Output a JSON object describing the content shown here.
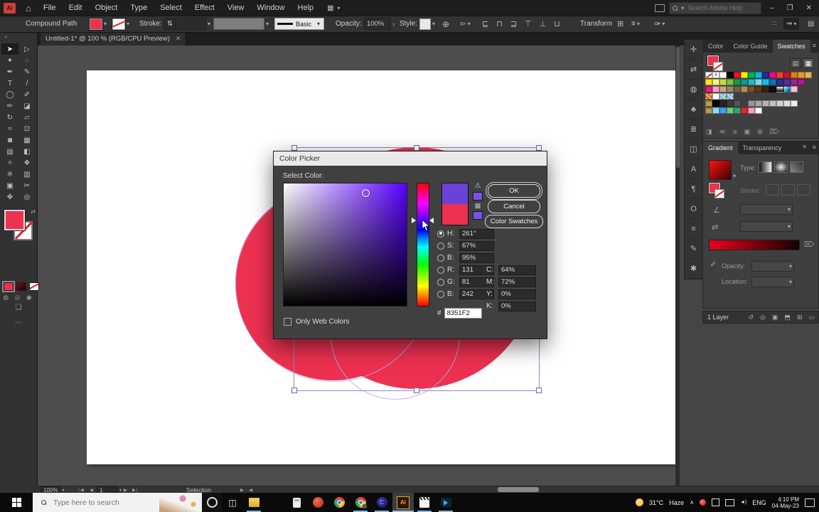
{
  "branding": {
    "ai_badge": "Ai"
  },
  "menubar": {
    "items": [
      "File",
      "Edit",
      "Object",
      "Type",
      "Select",
      "Effect",
      "View",
      "Window",
      "Help"
    ],
    "search_placeholder": "Search Adobe Help"
  },
  "control_bar": {
    "context_label": "Compound Path",
    "stroke_label": "Stroke:",
    "basic_label": "Basic",
    "opacity_label": "Opacity:",
    "opacity_value": "100%",
    "style_label": "Style:",
    "transform_label": "Transform",
    "align_glyphs": [
      "⊑",
      "⊓",
      "⊒",
      "⊤",
      "⊥",
      "⊔"
    ]
  },
  "document": {
    "tab_title": "Untitled-1* @ 100 % (RGB/CPU Preview)"
  },
  "toolbar": {
    "tools": [
      {
        "name": "selection",
        "glyph": "➤",
        "active": true
      },
      {
        "name": "direct-selection",
        "glyph": "▷"
      },
      {
        "name": "magic-wand",
        "glyph": "✦"
      },
      {
        "name": "lasso",
        "glyph": "◌"
      },
      {
        "name": "pen",
        "glyph": "✒"
      },
      {
        "name": "curvature",
        "glyph": "✎"
      },
      {
        "name": "type",
        "glyph": "T"
      },
      {
        "name": "line-segment",
        "glyph": "/"
      },
      {
        "name": "ellipse",
        "glyph": "◯"
      },
      {
        "name": "paintbrush",
        "glyph": "✐"
      },
      {
        "name": "pencil",
        "glyph": "✏"
      },
      {
        "name": "eraser",
        "glyph": "◪"
      },
      {
        "name": "rotate",
        "glyph": "↻"
      },
      {
        "name": "scale",
        "glyph": "▱"
      },
      {
        "name": "width",
        "glyph": "≈"
      },
      {
        "name": "free-transform",
        "glyph": "⊡"
      },
      {
        "name": "shape-builder",
        "glyph": "◙"
      },
      {
        "name": "perspective-grid",
        "glyph": "▦"
      },
      {
        "name": "mesh",
        "glyph": "▤"
      },
      {
        "name": "gradient",
        "glyph": "◧"
      },
      {
        "name": "eyedropper",
        "glyph": "✧"
      },
      {
        "name": "blend",
        "glyph": "❖"
      },
      {
        "name": "symbol-sprayer",
        "glyph": "※"
      },
      {
        "name": "column-graph",
        "glyph": "▥"
      },
      {
        "name": "artboard",
        "glyph": "▣"
      },
      {
        "name": "slice",
        "glyph": "✂"
      },
      {
        "name": "hand",
        "glyph": "✥"
      },
      {
        "name": "zoom",
        "glyph": "◎"
      }
    ],
    "more_glyph": "…"
  },
  "canvas": {
    "artwork_color": "#ED3150"
  },
  "dialog": {
    "title": "Color Picker",
    "select_label": "Select Color:",
    "ok": "OK",
    "cancel": "Cancel",
    "color_swatches": "Color Swatches",
    "only_web": "Only Web Colors",
    "hue_degrees": 261,
    "new_color": "#6B41D9",
    "current_color": "#ED3150",
    "rows": [
      {
        "key": "h",
        "label": "H:",
        "value": "261°",
        "selected": true
      },
      {
        "key": "s",
        "label": "S:",
        "value": "67%"
      },
      {
        "key": "b",
        "label": "B:",
        "value": "95%"
      },
      {
        "key": "r",
        "label": "R:",
        "value": "131"
      },
      {
        "key": "g",
        "label": "G:",
        "value": "81"
      },
      {
        "key": "b2",
        "label": "B:",
        "value": "242"
      }
    ],
    "cmyk": [
      {
        "label": "C:",
        "value": "64%"
      },
      {
        "label": "M:",
        "value": "72%"
      },
      {
        "label": "Y:",
        "value": "0%"
      },
      {
        "label": "K:",
        "value": "0%"
      }
    ],
    "hex_label": "#",
    "hex_value": "8351F2"
  },
  "dock": {
    "icons": [
      {
        "name": "transform",
        "glyph": "✛"
      },
      {
        "name": "properties",
        "glyph": "⇄"
      },
      {
        "name": "appearance",
        "glyph": "◍"
      },
      {
        "name": "symbols",
        "glyph": "♣"
      },
      {
        "name": "align",
        "glyph": "≣"
      },
      {
        "name": "pathfinder",
        "glyph": "◫"
      },
      {
        "name": "character",
        "glyph": "A"
      },
      {
        "name": "paragraph",
        "glyph": "¶"
      },
      {
        "name": "glyphs",
        "glyph": "O"
      },
      {
        "name": "stroke",
        "glyph": "≡"
      },
      {
        "name": "graphic-styles",
        "glyph": "✎"
      },
      {
        "name": "actions",
        "glyph": "✱"
      }
    ]
  },
  "swatches_panel": {
    "tabs": [
      {
        "label": "Color"
      },
      {
        "label": "Color Guide"
      },
      {
        "label": "Swatches",
        "active": true
      }
    ],
    "rows": [
      [
        "none",
        "reg",
        "#ffffff",
        "#000000",
        "#e8112d",
        "#f7ea0f",
        "#0db14b",
        "#0bb7e8",
        "#1e2f8f",
        "#e80b8c",
        "#e8432a",
        "#c4153f",
        "#e87a12",
        "#e89a2d",
        "#ecb34e"
      ],
      [
        "#f7e71c",
        "#fbf383",
        "#c9dc45",
        "#7cc245",
        "#159c4a",
        "#0d9e8d",
        "#2fb5c8",
        "#83d5e6",
        "#14bdf0",
        "#1272b8",
        "#283291",
        "#5b2d90",
        "#8f2890",
        "#b11b8d"
      ],
      [
        "#e41c78",
        "#f2a2c2",
        "#c4a77f",
        "#99896c",
        "#6d6252",
        "#ad8d58",
        "#794f2c",
        "#5c3917",
        "#3a2212",
        "#150e09",
        "grad-bw",
        "grad-cyan",
        "#f5bed4"
      ],
      [
        "pat-warm",
        "#ffffff",
        "pat-cool",
        "pat-cool"
      ],
      [
        "folder",
        "#090909",
        "#262626",
        "#3c3c3c",
        "#545454",
        null,
        "#989898",
        "#a6a6a6",
        "#b4b4b4",
        "#c2c2c2",
        "#d0d0d0",
        "#dedede",
        "#ededed"
      ],
      [
        "folder",
        "#8ed8f8",
        "#3f9ff5",
        "#7cc576",
        "#2fa37c",
        "#e8232e",
        "#f2a0c0",
        "#fafafa"
      ]
    ],
    "bottom_icons": [
      {
        "name": "swatch-libraries",
        "glyph": "◨"
      },
      {
        "name": "swatch-kinds",
        "glyph": "≪"
      },
      {
        "name": "swatch-options",
        "glyph": "⧈"
      },
      {
        "name": "new-color-group",
        "glyph": "▣"
      },
      {
        "name": "new-swatch",
        "glyph": "⊞"
      },
      {
        "name": "delete-swatch",
        "glyph": "⌦"
      }
    ]
  },
  "gradient_panel": {
    "tabs": [
      {
        "label": "Gradient",
        "active": true
      },
      {
        "label": "Transparency"
      }
    ],
    "type_label": "Type:",
    "stroke_label": "Stroke:",
    "opacity_label": "Opacity:",
    "location_label": "Location:",
    "gradient_from": "#e8001c",
    "gradient_to": "#140000"
  },
  "layers": {
    "count_label": "1 Layer",
    "icons": [
      {
        "name": "collect-for-export",
        "glyph": "↺"
      },
      {
        "name": "locate-object",
        "glyph": "◎"
      },
      {
        "name": "make-clipping-mask",
        "glyph": "▣"
      },
      {
        "name": "new-sublayer",
        "glyph": "⬒"
      },
      {
        "name": "new-layer",
        "glyph": "⊞"
      },
      {
        "name": "delete-layer",
        "glyph": "▭"
      }
    ]
  },
  "statusbar": {
    "zoom_value": "100%",
    "artboard_value": "1",
    "status_text": "Selection",
    "nav_glyphs": [
      "|◀",
      "◀",
      "▶",
      "▶|"
    ],
    "arrow_glyphs": [
      "▶",
      "◀"
    ]
  },
  "taskbar": {
    "search_placeholder": "Type here to search",
    "icons": [
      {
        "name": "task-view-icon",
        "running": false
      },
      {
        "name": "file-explorer-icon",
        "running": true
      },
      {
        "name": "kmplayer-icon",
        "running": false
      },
      {
        "name": "calculator-icon",
        "running": false
      },
      {
        "name": "powerdvd-icon",
        "running": false
      },
      {
        "name": "chrome-icon",
        "running": false
      },
      {
        "name": "chrome-profile-icon",
        "running": true
      },
      {
        "name": "blue-orb-app-icon",
        "running": true
      },
      {
        "name": "illustrator-icon",
        "running": true,
        "active": true
      },
      {
        "name": "movies-app-icon",
        "running": true
      },
      {
        "name": "screen-recorder-icon",
        "running": true
      }
    ],
    "tray": {
      "temperature": "31°C",
      "condition": "Haze",
      "language": "ENG",
      "time": "4:10 PM",
      "date": "04-May-23"
    }
  },
  "icons": {
    "chevron": "▾",
    "small_right": "›",
    "stepper": "⇅",
    "home": "⌂",
    "globe": "⊕",
    "doc_arrange": "▻",
    "menu": "≡",
    "grid": "▦",
    "dots": "∷",
    "share": "⇒",
    "panel_list": "▤",
    "close": "✕",
    "minimize": "–",
    "restore": "❐",
    "swap": "⇄",
    "warning": "⚠",
    "web_cube": "▩",
    "up_chevron": "∧",
    "volume": "◄)",
    "collapse": "«",
    "drawing_modes": [
      "◍",
      "◎",
      "◉"
    ],
    "screen_mode": "❏",
    "task_view": "◫"
  }
}
